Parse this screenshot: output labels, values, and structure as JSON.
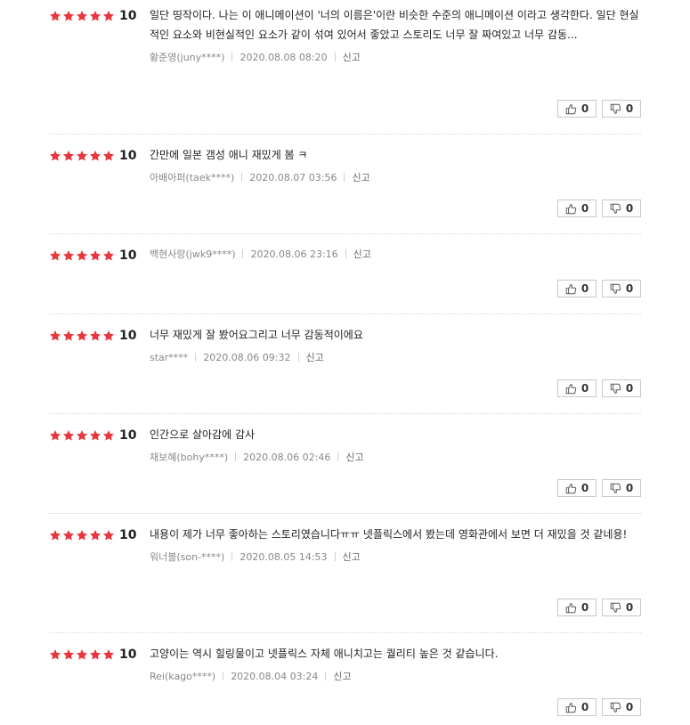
{
  "reviews": [
    {
      "score": "10",
      "text": "일단 띵작이다. 나는 이 애니메이션이 '너의 이름은'이란 비슷한 수준의 애니메이션 이라고 생각한다. 일단 현실적인 요소와 비현실적인 요소가 같이 섞여 있어서 좋았고 스토리도 너무 잘 짜여있고 너무 감동...",
      "author": "황준영(juny****)",
      "date": "2020.08.08 08:20",
      "report": "신고",
      "like": "0",
      "dislike": "0"
    },
    {
      "score": "10",
      "text": "간만에 일본 갬성 애니 재밌게 봄 ㅋ",
      "author": "아배아퍼(taek****)",
      "date": "2020.08.07 03:56",
      "report": "신고",
      "like": "0",
      "dislike": "0"
    },
    {
      "score": "10",
      "text": "",
      "author": "백현사랑(jwk9****)",
      "date": "2020.08.06 23:16",
      "report": "신고",
      "like": "0",
      "dislike": "0"
    },
    {
      "score": "10",
      "text": "너무 재밌게 잘 봤어요그리고 너무 감동적이에요",
      "author": "star****",
      "date": "2020.08.06 09:32",
      "report": "신고",
      "like": "0",
      "dislike": "0"
    },
    {
      "score": "10",
      "text": "인간으로 살아감에 감사",
      "author": "채보혜(bohy****)",
      "date": "2020.08.06 02:46",
      "report": "신고",
      "like": "0",
      "dislike": "0"
    },
    {
      "score": "10",
      "text": "내용이 제가 너무 좋아하는 스토리였습니다ㅠㅠ 넷플릭스에서 봤는데 영화관에서 보면 더 재밌을 것 같네용!",
      "author": "워너블(son-****)",
      "date": "2020.08.05 14:53",
      "report": "신고",
      "like": "0",
      "dislike": "0"
    },
    {
      "score": "10",
      "text": "고양이는 역시 힐링물이고 넷플릭스 자체 애니치고는 퀄리티 높은 것 같습니다.",
      "author": "Rei(kago****)",
      "date": "2020.08.04 03:24",
      "report": "신고",
      "like": "0",
      "dislike": "0"
    }
  ],
  "colors": {
    "star": "#e8373f",
    "star_empty": "#e0e0e0",
    "border": "#c8c8c8"
  },
  "icons": {
    "like": "thumbs-up-icon",
    "dislike": "thumbs-down-icon",
    "rating": "star-icon"
  }
}
